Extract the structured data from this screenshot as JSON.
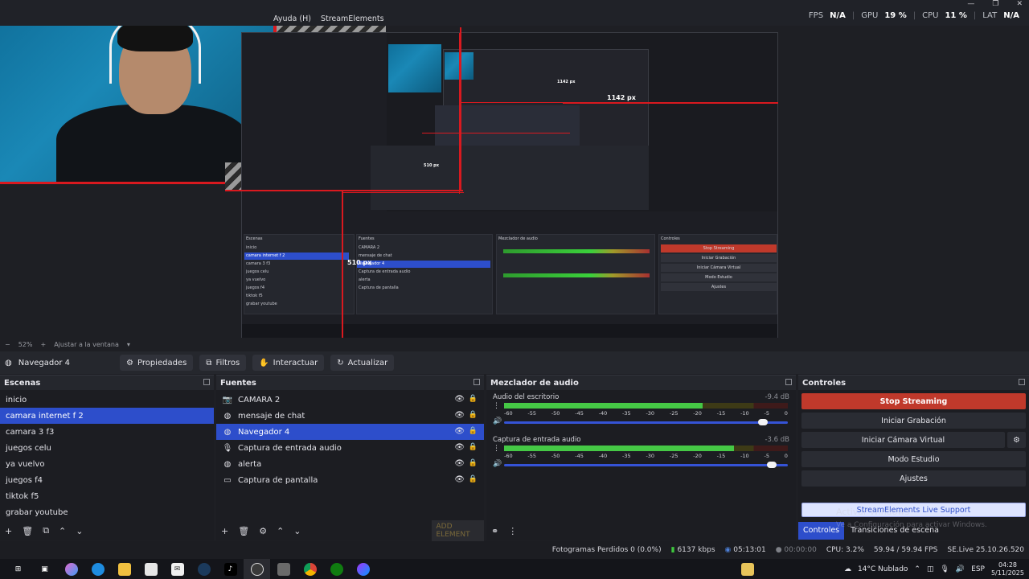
{
  "menu": [
    "Ayuda (H)",
    "StreamElements"
  ],
  "perf": {
    "fps_label": "FPS",
    "fps": "N/A",
    "gpu_label": "GPU",
    "gpu": "19 %",
    "cpu_label": "CPU",
    "cpu": "11 %",
    "lat_label": "LAT",
    "lat": "N/A"
  },
  "preview": {
    "measure_1": "1142 px",
    "measure_2": "510 px",
    "inner_1142": "1142 px",
    "inner_510": "510 px",
    "mini_scenes": [
      "inicio",
      "camara internet f 2",
      "camara 3 f3",
      "juegos celu",
      "ya vuelvo",
      "juegos f4",
      "tiktok f5",
      "grabar youtube"
    ],
    "mini_sources": [
      "CAMARA 2",
      "mensaje de chat",
      "Navegador 4",
      "Captura de entrada audio",
      "alerta",
      "Captura de pantalla"
    ],
    "mini_controls": [
      "Stop Streaming",
      "Iniciar Grabación",
      "Iniciar Cámara Virtual",
      "Modo Estudio",
      "Ajustes"
    ],
    "mini_scenes_title": "Escenas",
    "mini_sources_title": "Fuentes",
    "mini_mixer_title": "Mezclador de audio",
    "mini_controls_title": "Controles"
  },
  "zoom": {
    "level": "52%",
    "fit": "Ajustar a la ventana"
  },
  "source_toolbar": {
    "name": "Navegador 4",
    "props": "Propiedades",
    "filters": "Filtros",
    "interact": "Interactuar",
    "refresh": "Actualizar"
  },
  "scenes": {
    "title": "Escenas",
    "items": [
      "inicio",
      "camara internet f 2",
      "camara 3 f3",
      "juegos celu",
      "ya vuelvo",
      "juegos f4",
      "tiktok f5",
      "grabar youtube"
    ],
    "selected_index": 1
  },
  "sources": {
    "title": "Fuentes",
    "items": [
      {
        "name": "CAMARA 2",
        "icon": "camera-icon"
      },
      {
        "name": "mensaje de chat",
        "icon": "globe-icon"
      },
      {
        "name": "Navegador 4",
        "icon": "globe-icon"
      },
      {
        "name": "Captura de entrada audio",
        "icon": "microphone-icon"
      },
      {
        "name": "alerta",
        "icon": "globe-icon"
      },
      {
        "name": "Captura de pantalla",
        "icon": "monitor-icon"
      }
    ],
    "selected_index": 2,
    "add_label": "ADD ELEMENT"
  },
  "mixer": {
    "title": "Mezclador de audio",
    "tracks": [
      {
        "name": "Audio del escritorio",
        "db": "-9.4 dB",
        "level": 0.7,
        "volume": 0.93
      },
      {
        "name": "Captura de entrada audio",
        "db": "-3.6 dB",
        "level": 0.81,
        "volume": 0.96
      }
    ],
    "scale": [
      "-60",
      "-55",
      "-50",
      "-45",
      "-40",
      "-35",
      "-30",
      "-25",
      "-20",
      "-15",
      "-10",
      "-5",
      "0"
    ]
  },
  "controls": {
    "title": "Controles",
    "stop": "Stop Streaming",
    "record": "Iniciar Grabación",
    "vcam": "Iniciar Cámara Virtual",
    "studio": "Modo Estudio",
    "settings": "Ajustes",
    "se_support": "StreamElements Live Support",
    "tab_controls": "Controles",
    "tab_transitions": "Transiciones de escena"
  },
  "watermark": {
    "line1": "Activar Windows",
    "line2": "Ve a Configuración para activar Windows."
  },
  "status": {
    "dropped": "Fotogramas Perdidos 0 (0.0%)",
    "kbps": "6137 kbps",
    "live_time": "05:13:01",
    "rec_time": "00:00:00",
    "cpu": "CPU: 3.2%",
    "fps": "59.94 / 59.94 FPS",
    "version": "SE.Live 25.10.26.520"
  },
  "taskbar": {
    "weather": "14°C  Nublado",
    "lang": "ESP",
    "time": "04:28",
    "date": "5/11/2025"
  },
  "colors": {
    "accent": "#2d4ecb",
    "stop": "#c0392b",
    "meter_green": "#45c845",
    "frame_red": "#d9191f"
  }
}
